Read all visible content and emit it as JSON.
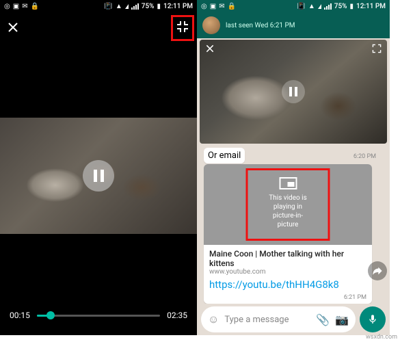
{
  "watermark": "wsxdn.com",
  "left": {
    "statusbar": {
      "battery": "75%",
      "time": "12:11 PM"
    },
    "progress": {
      "current": "00:15",
      "total": "02:35",
      "pct": 11
    }
  },
  "right": {
    "statusbar": {
      "battery": "75%",
      "time": "12:11 PM"
    },
    "header": {
      "last_seen": "last seen Wed 6:21 PM"
    },
    "bubble1": {
      "text": "Or email",
      "time": "6:20 PM"
    },
    "linkcard": {
      "pip_msg_l1": "This video is playing in",
      "pip_msg_l2": "picture-in-picture",
      "title": "Maine Coon | Mother talking with her kittens",
      "source": "www.youtube.com",
      "url": "https://youtu.be/thHH4G8k8",
      "time": "6:21 PM"
    },
    "composer": {
      "placeholder": "Type a message"
    }
  }
}
